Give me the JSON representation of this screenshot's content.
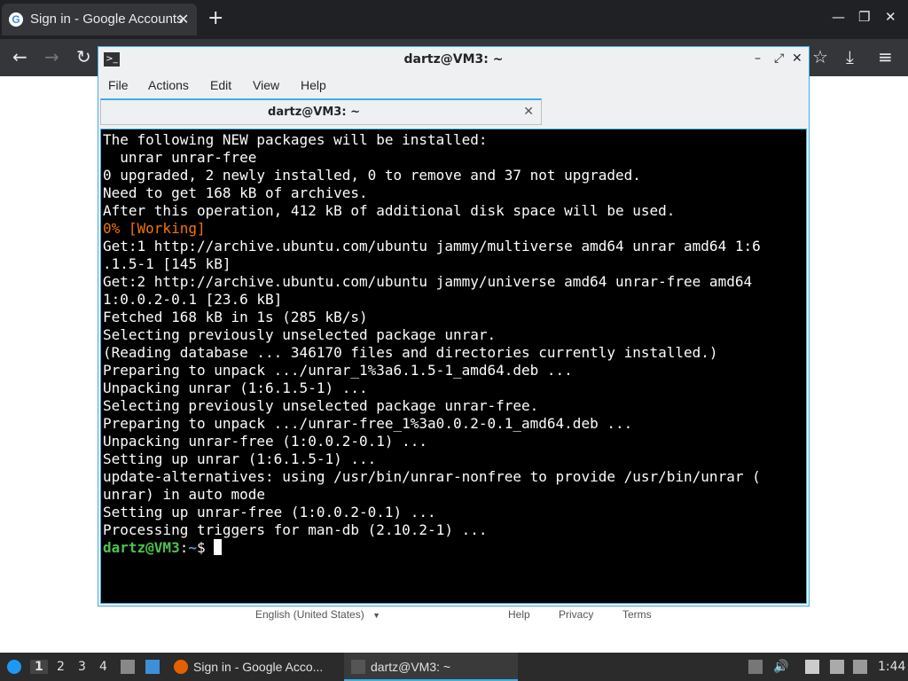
{
  "browser": {
    "tab_title": "Sign in - Google Accounts",
    "tab_close": "✕",
    "new_tab": "+",
    "window_controls": [
      "—",
      "❐",
      "✕"
    ]
  },
  "page": {
    "footer": {
      "language": "English (United States)",
      "help": "Help",
      "privacy": "Privacy",
      "terms": "Terms"
    }
  },
  "terminal": {
    "window_title": "dartz@VM3: ~",
    "menu": [
      "File",
      "Actions",
      "Edit",
      "View",
      "Help"
    ],
    "tab_label": "dartz@VM3: ~",
    "lines": [
      {
        "text": "The following NEW packages will be installed:",
        "style": "normal"
      },
      {
        "text": "  unrar unrar-free",
        "style": "normal"
      },
      {
        "text": "0 upgraded, 2 newly installed, 0 to remove and 37 not upgraded.",
        "style": "normal"
      },
      {
        "text": "Need to get 168 kB of archives.",
        "style": "normal"
      },
      {
        "text": "After this operation, 412 kB of additional disk space will be used.",
        "style": "normal"
      },
      {
        "text": "0% [Working]",
        "style": "orange"
      },
      {
        "text": "Get:1 http://archive.ubuntu.com/ubuntu jammy/multiverse amd64 unrar amd64 1:6",
        "style": "normal"
      },
      {
        "text": ".1.5-1 [145 kB]",
        "style": "normal"
      },
      {
        "text": "Get:2 http://archive.ubuntu.com/ubuntu jammy/universe amd64 unrar-free amd64",
        "style": "normal"
      },
      {
        "text": "1:0.0.2-0.1 [23.6 kB]",
        "style": "normal"
      },
      {
        "text": "Fetched 168 kB in 1s (285 kB/s)",
        "style": "normal"
      },
      {
        "text": "Selecting previously unselected package unrar.",
        "style": "normal"
      },
      {
        "text": "(Reading database ... 346170 files and directories currently installed.)",
        "style": "normal"
      },
      {
        "text": "Preparing to unpack .../unrar_1%3a6.1.5-1_amd64.deb ...",
        "style": "normal"
      },
      {
        "text": "Unpacking unrar (1:6.1.5-1) ...",
        "style": "normal"
      },
      {
        "text": "Selecting previously unselected package unrar-free.",
        "style": "normal"
      },
      {
        "text": "Preparing to unpack .../unrar-free_1%3a0.0.2-0.1_amd64.deb ...",
        "style": "normal"
      },
      {
        "text": "Unpacking unrar-free (1:0.0.2-0.1) ...",
        "style": "normal"
      },
      {
        "text": "Setting up unrar (1:6.1.5-1) ...",
        "style": "normal"
      },
      {
        "text": "update-alternatives: using /usr/bin/unrar-nonfree to provide /usr/bin/unrar (",
        "style": "normal"
      },
      {
        "text": "unrar) in auto mode",
        "style": "normal"
      },
      {
        "text": "Setting up unrar-free (1:0.0.2-0.1) ...",
        "style": "normal"
      },
      {
        "text": "Processing triggers for man-db (2.10.2-1) ...",
        "style": "normal"
      }
    ],
    "prompt": {
      "user_host": "dartz@VM3",
      "sep": ":",
      "path": "~",
      "symbol": "$ "
    }
  },
  "taskbar": {
    "workspaces": [
      "1",
      "2",
      "3",
      "4"
    ],
    "tasks": [
      {
        "label": "Sign in - Google Acco..."
      },
      {
        "label": "dartz@VM3: ~"
      }
    ],
    "clock": "1:44"
  }
}
